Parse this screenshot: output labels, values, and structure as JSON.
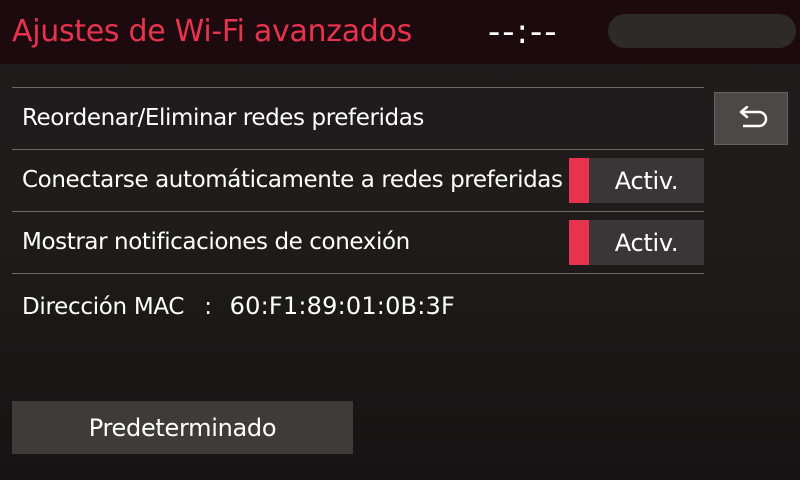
{
  "header": {
    "title": "Ajustes de Wi-Fi avanzados",
    "clock": "--:--"
  },
  "settings": {
    "items": [
      {
        "label": "Reordenar/Eliminar redes preferidas"
      },
      {
        "label": "Conectarse automáticamente a redes preferidas",
        "toggle_label": "Activ.",
        "toggle_on": true
      },
      {
        "label": "Mostrar notificaciones de conexión",
        "toggle_label": "Activ.",
        "toggle_on": true
      }
    ]
  },
  "mac": {
    "label": "Dirección MAC",
    "separator": ":",
    "value": "60:F1:89:01:0B:3F"
  },
  "footer": {
    "default_label": "Predeterminado"
  },
  "icons": {
    "back": "back-arrow-icon"
  },
  "colors": {
    "accent": "#e8334f",
    "header_bg": "#1c0a0e",
    "button_bg": "#3f3b3b"
  }
}
